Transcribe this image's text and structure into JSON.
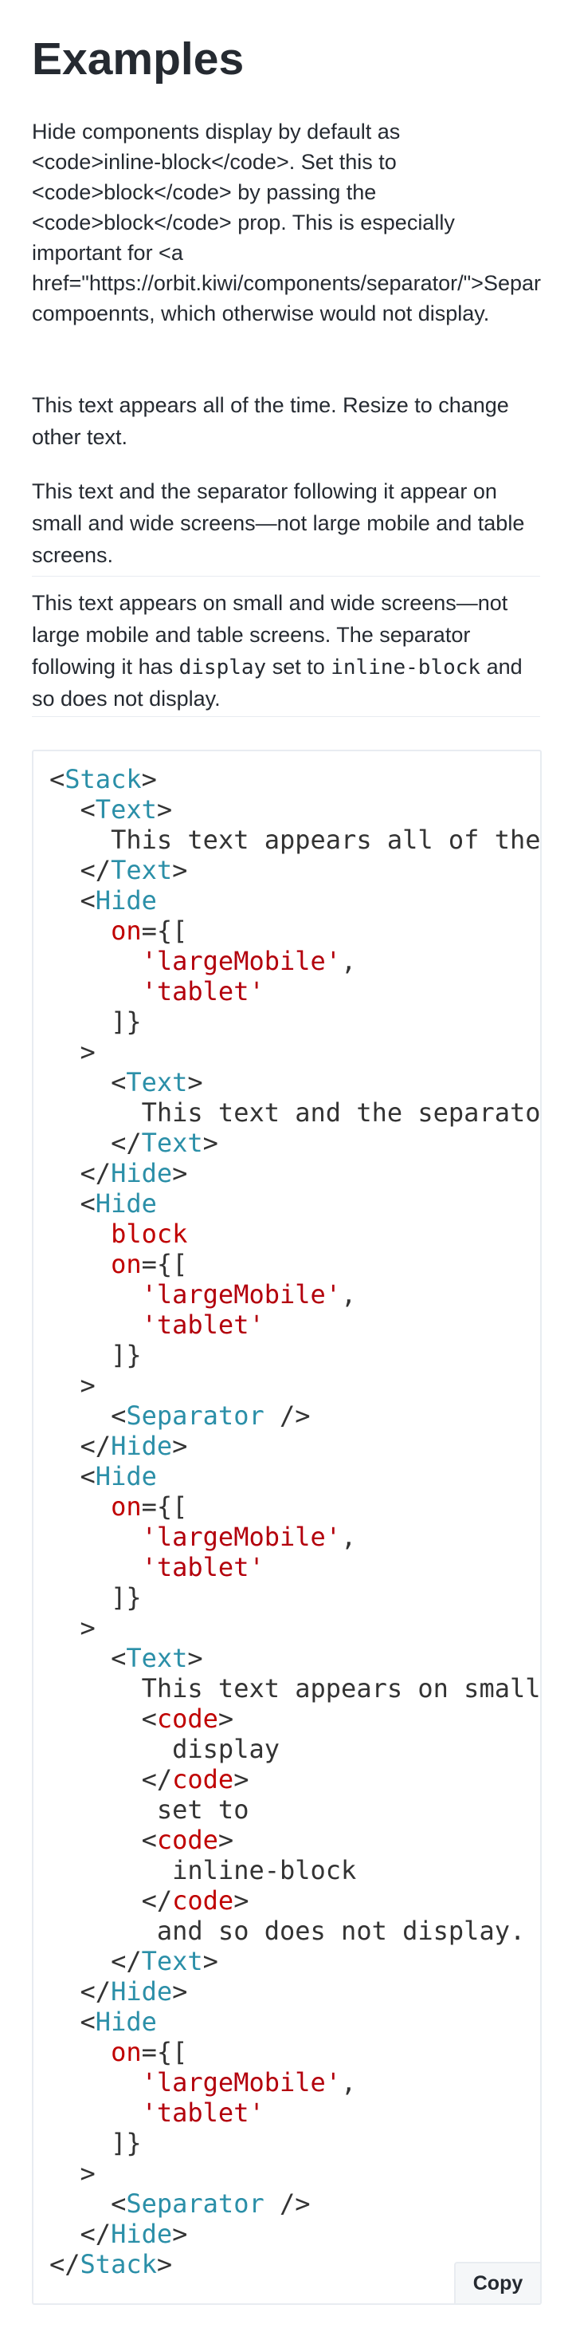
{
  "page": {
    "title": "Examples",
    "intro_lines": [
      "Hide components display by default as",
      "<code>inline-block</code>. Set this to",
      "<code>block</code> by passing the",
      "<code>block</code> prop. This is especially",
      "important for <a",
      "href=\"https://orbit.kiwi/components/separator/\">Separ",
      "compoennts, which otherwise would not display."
    ]
  },
  "demo": {
    "text_1_lines": [
      "This text appears all of the time. Resize to change",
      "other text."
    ],
    "text_2_lines": [
      "This text and the separator following it appear on",
      "small and wide screens—not large mobile and table",
      "screens."
    ],
    "text_3": {
      "line_1": "This text appears on small and wide screens—not",
      "line_2": "large mobile and table screens. The separator",
      "line_3_pre": "following it has ",
      "line_3_code_1": "display",
      "line_3_mid": " set to ",
      "line_3_code_2": "inline-block",
      "line_3_post": " and",
      "line_4": "so does not display."
    }
  },
  "code_example": {
    "copy_label": "Copy",
    "lines": [
      [
        {
          "t": "punc",
          "v": "<"
        },
        {
          "t": "tag",
          "v": "Stack"
        },
        {
          "t": "punc",
          "v": ">"
        }
      ],
      [
        {
          "t": "punc",
          "v": "  <"
        },
        {
          "t": "tag",
          "v": "Text"
        },
        {
          "t": "punc",
          "v": ">"
        }
      ],
      [
        {
          "t": "text",
          "v": "    This text appears all of the time. Resize to change other text."
        }
      ],
      [
        {
          "t": "punc",
          "v": "  </"
        },
        {
          "t": "tag",
          "v": "Text"
        },
        {
          "t": "punc",
          "v": ">"
        }
      ],
      [
        {
          "t": "punc",
          "v": "  <"
        },
        {
          "t": "tag",
          "v": "Hide"
        }
      ],
      [
        {
          "t": "attr",
          "v": "    on"
        },
        {
          "t": "punc",
          "v": "={["
        }
      ],
      [
        {
          "t": "str",
          "v": "      'largeMobile'"
        },
        {
          "t": "punc",
          "v": ","
        }
      ],
      [
        {
          "t": "str",
          "v": "      'tablet'"
        }
      ],
      [
        {
          "t": "punc",
          "v": "    ]}"
        }
      ],
      [
        {
          "t": "punc",
          "v": "  >"
        }
      ],
      [
        {
          "t": "punc",
          "v": "    <"
        },
        {
          "t": "tag",
          "v": "Text"
        },
        {
          "t": "punc",
          "v": ">"
        }
      ],
      [
        {
          "t": "text",
          "v": "      This text and the separator following it appear on small and wide screens"
        }
      ],
      [
        {
          "t": "punc",
          "v": "    </"
        },
        {
          "t": "tag",
          "v": "Text"
        },
        {
          "t": "punc",
          "v": ">"
        }
      ],
      [
        {
          "t": "punc",
          "v": "  </"
        },
        {
          "t": "tag",
          "v": "Hide"
        },
        {
          "t": "punc",
          "v": ">"
        }
      ],
      [
        {
          "t": "punc",
          "v": "  <"
        },
        {
          "t": "tag",
          "v": "Hide"
        }
      ],
      [
        {
          "t": "attr",
          "v": "    block"
        }
      ],
      [
        {
          "t": "attr",
          "v": "    on"
        },
        {
          "t": "punc",
          "v": "={["
        }
      ],
      [
        {
          "t": "str",
          "v": "      'largeMobile'"
        },
        {
          "t": "punc",
          "v": ","
        }
      ],
      [
        {
          "t": "str",
          "v": "      'tablet'"
        }
      ],
      [
        {
          "t": "punc",
          "v": "    ]}"
        }
      ],
      [
        {
          "t": "punc",
          "v": "  >"
        }
      ],
      [
        {
          "t": "punc",
          "v": "    <"
        },
        {
          "t": "tag",
          "v": "Separator"
        },
        {
          "t": "punc",
          "v": " />"
        }
      ],
      [
        {
          "t": "punc",
          "v": "  </"
        },
        {
          "t": "tag",
          "v": "Hide"
        },
        {
          "t": "punc",
          "v": ">"
        }
      ],
      [
        {
          "t": "punc",
          "v": "  <"
        },
        {
          "t": "tag",
          "v": "Hide"
        }
      ],
      [
        {
          "t": "attr",
          "v": "    on"
        },
        {
          "t": "punc",
          "v": "={["
        }
      ],
      [
        {
          "t": "str",
          "v": "      'largeMobile'"
        },
        {
          "t": "punc",
          "v": ","
        }
      ],
      [
        {
          "t": "str",
          "v": "      'tablet'"
        }
      ],
      [
        {
          "t": "punc",
          "v": "    ]}"
        }
      ],
      [
        {
          "t": "punc",
          "v": "  >"
        }
      ],
      [
        {
          "t": "punc",
          "v": "    <"
        },
        {
          "t": "tag",
          "v": "Text"
        },
        {
          "t": "punc",
          "v": ">"
        }
      ],
      [
        {
          "t": "text",
          "v": "      This text appears on small and wide screens"
        }
      ],
      [
        {
          "t": "punc",
          "v": "      <"
        },
        {
          "t": "attr",
          "v": "code"
        },
        {
          "t": "punc",
          "v": ">"
        }
      ],
      [
        {
          "t": "text",
          "v": "        display"
        }
      ],
      [
        {
          "t": "punc",
          "v": "      </"
        },
        {
          "t": "attr",
          "v": "code"
        },
        {
          "t": "punc",
          "v": ">"
        }
      ],
      [
        {
          "t": "text",
          "v": "       set to"
        }
      ],
      [
        {
          "t": "punc",
          "v": "      <"
        },
        {
          "t": "attr",
          "v": "code"
        },
        {
          "t": "punc",
          "v": ">"
        }
      ],
      [
        {
          "t": "text",
          "v": "        inline-block"
        }
      ],
      [
        {
          "t": "punc",
          "v": "      </"
        },
        {
          "t": "attr",
          "v": "code"
        },
        {
          "t": "punc",
          "v": ">"
        }
      ],
      [
        {
          "t": "text",
          "v": "       and so does not display."
        }
      ],
      [
        {
          "t": "punc",
          "v": "    </"
        },
        {
          "t": "tag",
          "v": "Text"
        },
        {
          "t": "punc",
          "v": ">"
        }
      ],
      [
        {
          "t": "punc",
          "v": "  </"
        },
        {
          "t": "tag",
          "v": "Hide"
        },
        {
          "t": "punc",
          "v": ">"
        }
      ],
      [
        {
          "t": "punc",
          "v": "  <"
        },
        {
          "t": "tag",
          "v": "Hide"
        }
      ],
      [
        {
          "t": "attr",
          "v": "    on"
        },
        {
          "t": "punc",
          "v": "={["
        }
      ],
      [
        {
          "t": "str",
          "v": "      'largeMobile'"
        },
        {
          "t": "punc",
          "v": ","
        }
      ],
      [
        {
          "t": "str",
          "v": "      'tablet'"
        }
      ],
      [
        {
          "t": "punc",
          "v": "    ]}"
        }
      ],
      [
        {
          "t": "punc",
          "v": "  >"
        }
      ],
      [
        {
          "t": "punc",
          "v": "    <"
        },
        {
          "t": "tag",
          "v": "Separator"
        },
        {
          "t": "punc",
          "v": " />"
        }
      ],
      [
        {
          "t": "punc",
          "v": "  </"
        },
        {
          "t": "tag",
          "v": "Hide"
        },
        {
          "t": "punc",
          "v": ">"
        }
      ],
      [
        {
          "t": "punc",
          "v": "</"
        },
        {
          "t": "tag",
          "v": "Stack"
        },
        {
          "t": "punc",
          "v": ">"
        }
      ]
    ]
  },
  "colors": {
    "text": "#252a31",
    "tag": "#2b8fa8",
    "attr": "#c00000",
    "string": "#b3000c",
    "border": "#e8ecf1"
  }
}
